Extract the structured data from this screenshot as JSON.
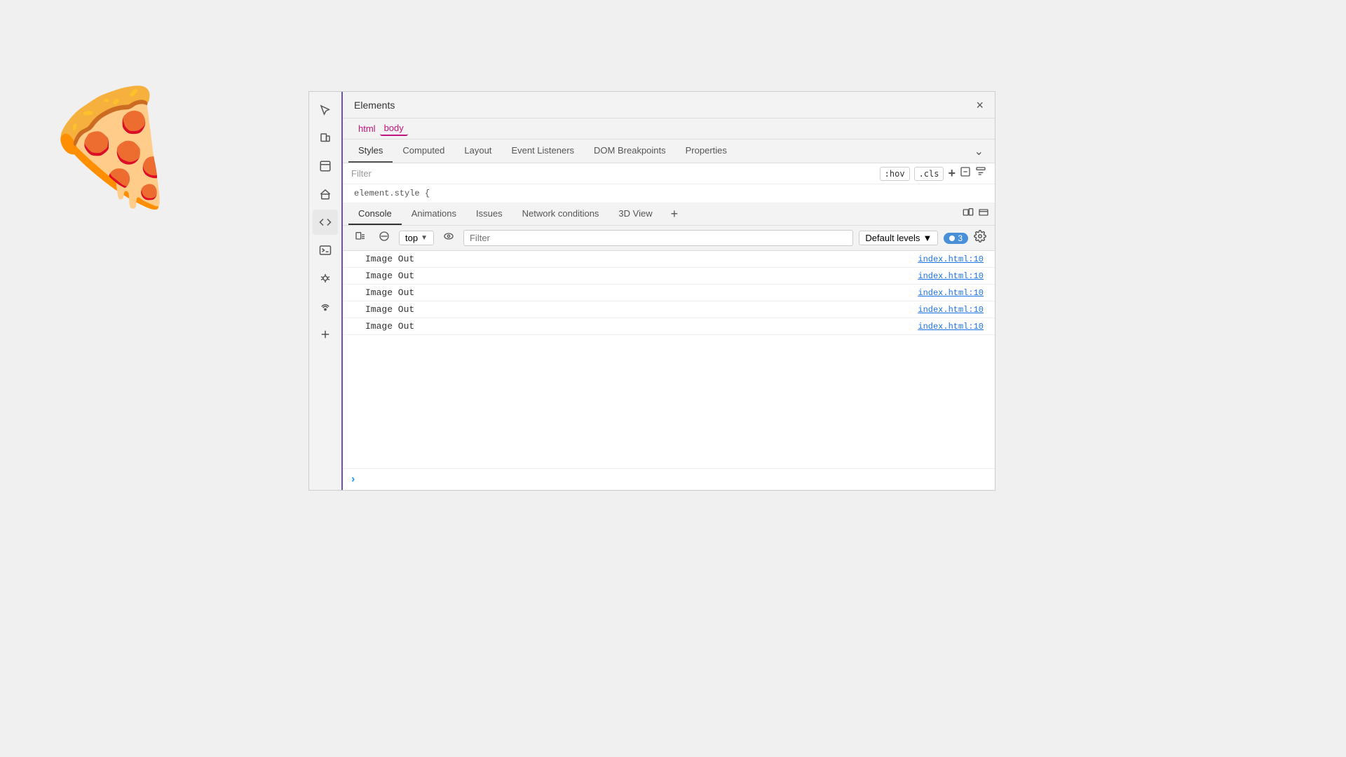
{
  "pizza": {
    "emoji": "🍕"
  },
  "devtools": {
    "title": "Elements",
    "close_btn": "×",
    "breadcrumbs": [
      {
        "label": "html",
        "state": "inactive"
      },
      {
        "label": "body",
        "state": "active"
      }
    ],
    "styles_tabs": [
      {
        "label": "Styles",
        "active": true
      },
      {
        "label": "Computed",
        "active": false
      },
      {
        "label": "Layout",
        "active": false
      },
      {
        "label": "Event Listeners",
        "active": false
      },
      {
        "label": "DOM Breakpoints",
        "active": false
      },
      {
        "label": "Properties",
        "active": false
      }
    ],
    "filter_placeholder": "Filter",
    "filter_hov_label": ":hov",
    "filter_cls_label": ".cls",
    "filter_plus": "+",
    "code_line": "element.style {",
    "console_tabs": [
      {
        "label": "Console",
        "active": true
      },
      {
        "label": "Animations",
        "active": false
      },
      {
        "label": "Issues",
        "active": false
      },
      {
        "label": "Network conditions",
        "active": false
      },
      {
        "label": "3D View",
        "active": false
      }
    ],
    "console_tab_plus": "+",
    "top_label": "top",
    "console_filter_placeholder": "Filter",
    "levels_label": "Default levels",
    "message_count": "3",
    "console_rows": [
      {
        "text": "Image Out",
        "link": "index.html:10"
      },
      {
        "text": "Image Out",
        "link": "index.html:10"
      },
      {
        "text": "Image Out",
        "link": "index.html:10"
      },
      {
        "text": "Image Out",
        "link": "index.html:10"
      },
      {
        "text": "Image Out",
        "link": "index.html:10"
      }
    ],
    "prompt_chevron": "›",
    "sidebar_icons": [
      {
        "name": "cursor-icon",
        "symbol": "↖",
        "title": "Select element"
      },
      {
        "name": "device-icon",
        "symbol": "⬜",
        "title": "Device toolbar"
      },
      {
        "name": "inspector-icon",
        "symbol": "◻",
        "title": "Inspector"
      },
      {
        "name": "home-icon",
        "symbol": "⌂",
        "title": "Home"
      },
      {
        "name": "code-icon",
        "symbol": "</>",
        "title": "Sources"
      },
      {
        "name": "terminal-icon",
        "symbol": "▶",
        "title": "Console"
      },
      {
        "name": "bug-icon",
        "symbol": "🐞",
        "title": "Debugger"
      },
      {
        "name": "network-icon",
        "symbol": "📶",
        "title": "Network"
      },
      {
        "name": "plus-icon",
        "symbol": "+",
        "title": "More"
      }
    ]
  }
}
